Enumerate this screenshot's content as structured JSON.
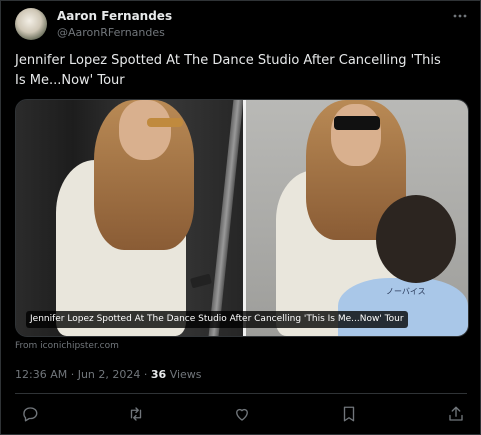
{
  "author": {
    "name": "Aaron Fernandes",
    "handle": "@AaronRFernandes"
  },
  "more_icon": "more-horizontal-icon",
  "tweet": {
    "text": "Jennifer Lopez Spotted At The Dance Studio After Cancelling 'This Is Me...Now' Tour"
  },
  "media": {
    "caption": "Jennifer Lopez Spotted At The Dance Studio After Cancelling 'This Is Me...Now' Tour",
    "tshirt_text": "ノーバイス"
  },
  "source": "From iconichipster.com",
  "meta": {
    "time": "12:36 AM",
    "dot1": " · ",
    "date": "Jun 2, 2024",
    "dot2": " · ",
    "views_count": "36",
    "views_label": " Views"
  },
  "actions": [
    {
      "icon": "reply-icon"
    },
    {
      "icon": "retweet-icon"
    },
    {
      "icon": "like-icon"
    },
    {
      "icon": "bookmark-icon"
    },
    {
      "icon": "share-icon"
    }
  ],
  "colors": {
    "background": "#000000",
    "text": "#e7e9ea",
    "secondary": "#71767b",
    "border": "#2f3336"
  }
}
